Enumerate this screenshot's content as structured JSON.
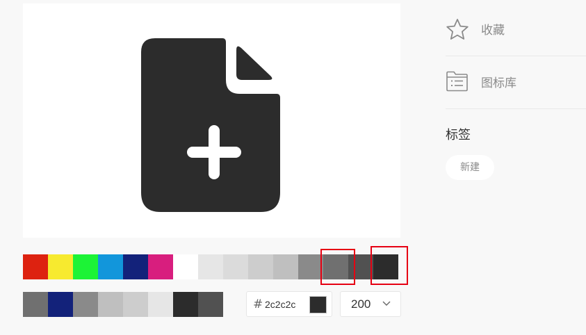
{
  "preview": {
    "icon_name": "file-add-icon",
    "icon_color": "#2c2c2c"
  },
  "palette": {
    "colors": [
      "#dd2210",
      "#f7ea2f",
      "#1cf336",
      "#1296db",
      "#13227a",
      "#d81e7e",
      "#ffffff",
      "#e6e6e6",
      "#dbdbdb",
      "#cdcdcd",
      "#bfbfbf",
      "#8a8a8a",
      "#707070",
      "#515151",
      "#2c2c2c"
    ],
    "highlight_color": "#e60012"
  },
  "history": {
    "colors": [
      "#707070",
      "#13227a",
      "#8a8a8a",
      "#bfbfbf",
      "#cdcdcd",
      "#e6e6e6",
      "#2c2c2c",
      "#515151"
    ]
  },
  "color_input": {
    "hash": "#",
    "value": "2c2c2c",
    "swatch": "#2c2c2c"
  },
  "size_select": {
    "value": "200"
  },
  "sidebar": {
    "favorite_label": "收藏",
    "library_label": "图标库",
    "tags_title": "标签",
    "new_tag_label": "新建"
  }
}
